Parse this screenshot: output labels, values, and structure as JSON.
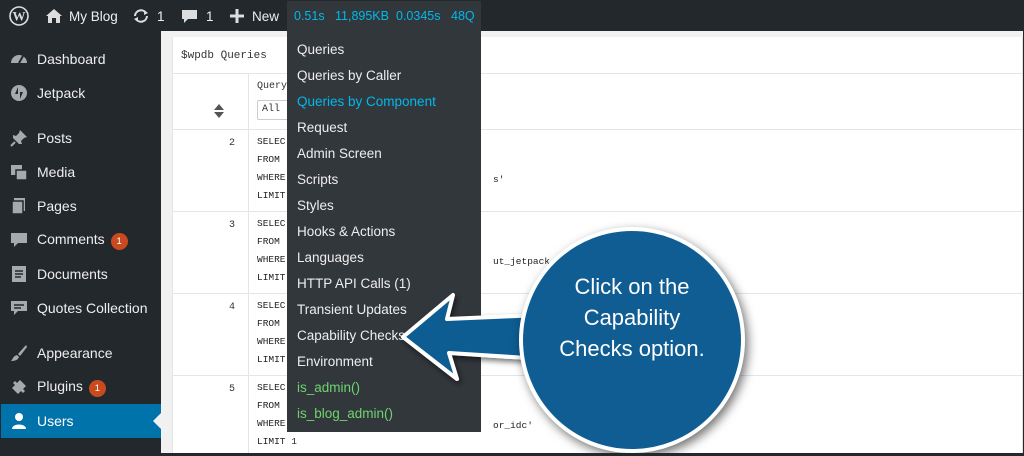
{
  "adminbar": {
    "site_name": "My Blog",
    "updates_count": "1",
    "comments_count": "1",
    "new_label": "New",
    "qm_stats": [
      "0.51s",
      "11,895KB",
      "0.0345s",
      "48Q"
    ]
  },
  "sidebar": {
    "items": [
      {
        "label": "Dashboard",
        "icon": "dashboard-icon"
      },
      {
        "label": "Jetpack",
        "icon": "jetpack-icon"
      },
      {
        "label": "Posts",
        "icon": "pin-icon"
      },
      {
        "label": "Media",
        "icon": "media-icon"
      },
      {
        "label": "Pages",
        "icon": "pages-icon"
      },
      {
        "label": "Comments",
        "icon": "comment-icon",
        "badge": "1"
      },
      {
        "label": "Documents",
        "icon": "document-icon"
      },
      {
        "label": "Quotes Collection",
        "icon": "quote-icon"
      },
      {
        "label": "Appearance",
        "icon": "brush-icon"
      },
      {
        "label": "Plugins",
        "icon": "plugin-icon",
        "badge": "1"
      },
      {
        "label": "Users",
        "icon": "user-icon",
        "current": true
      }
    ]
  },
  "panel": {
    "title": "$wpdb Queries",
    "th_query": "Query",
    "th_select": "All",
    "rows": [
      {
        "num": "2",
        "sql": "SELEC\nFROM \nWHERE\nLIMIT",
        "tail": "s'"
      },
      {
        "num": "3",
        "sql": "SELEC\nFROM \nWHERE\nLIMIT",
        "tail": "ut_jetpack"
      },
      {
        "num": "4",
        "sql": "SELEC\nFROM \nWHERE\nLIMIT",
        "tail": ""
      },
      {
        "num": "5",
        "sql": "SELEC\nFROM \nWHERE\nLIMIT 1",
        "tail": "or_idc'"
      }
    ]
  },
  "qm_menu": {
    "items": [
      {
        "label": "Queries"
      },
      {
        "label": "Queries by Caller"
      },
      {
        "label": "Queries by Component",
        "state": "active"
      },
      {
        "label": "Request"
      },
      {
        "label": "Admin Screen"
      },
      {
        "label": "Scripts"
      },
      {
        "label": "Styles"
      },
      {
        "label": "Hooks & Actions"
      },
      {
        "label": "Languages"
      },
      {
        "label": "HTTP API Calls (1)"
      },
      {
        "label": "Transient Updates"
      },
      {
        "label": "Capability Checks"
      },
      {
        "label": "Environment"
      },
      {
        "label": "is_admin()",
        "state": "green"
      },
      {
        "label": "is_blog_admin()",
        "state": "green"
      }
    ]
  },
  "callout": {
    "text_lines": [
      "Click on the",
      "Capability",
      "Checks option."
    ]
  },
  "colors": {
    "adminbar_bg": "#23282d",
    "qm_link": "#00b9eb",
    "current_item": "#0073aa",
    "badge": "#ca4a1f",
    "callout": "#0f5d92",
    "conditional_green": "#6fd46f"
  }
}
